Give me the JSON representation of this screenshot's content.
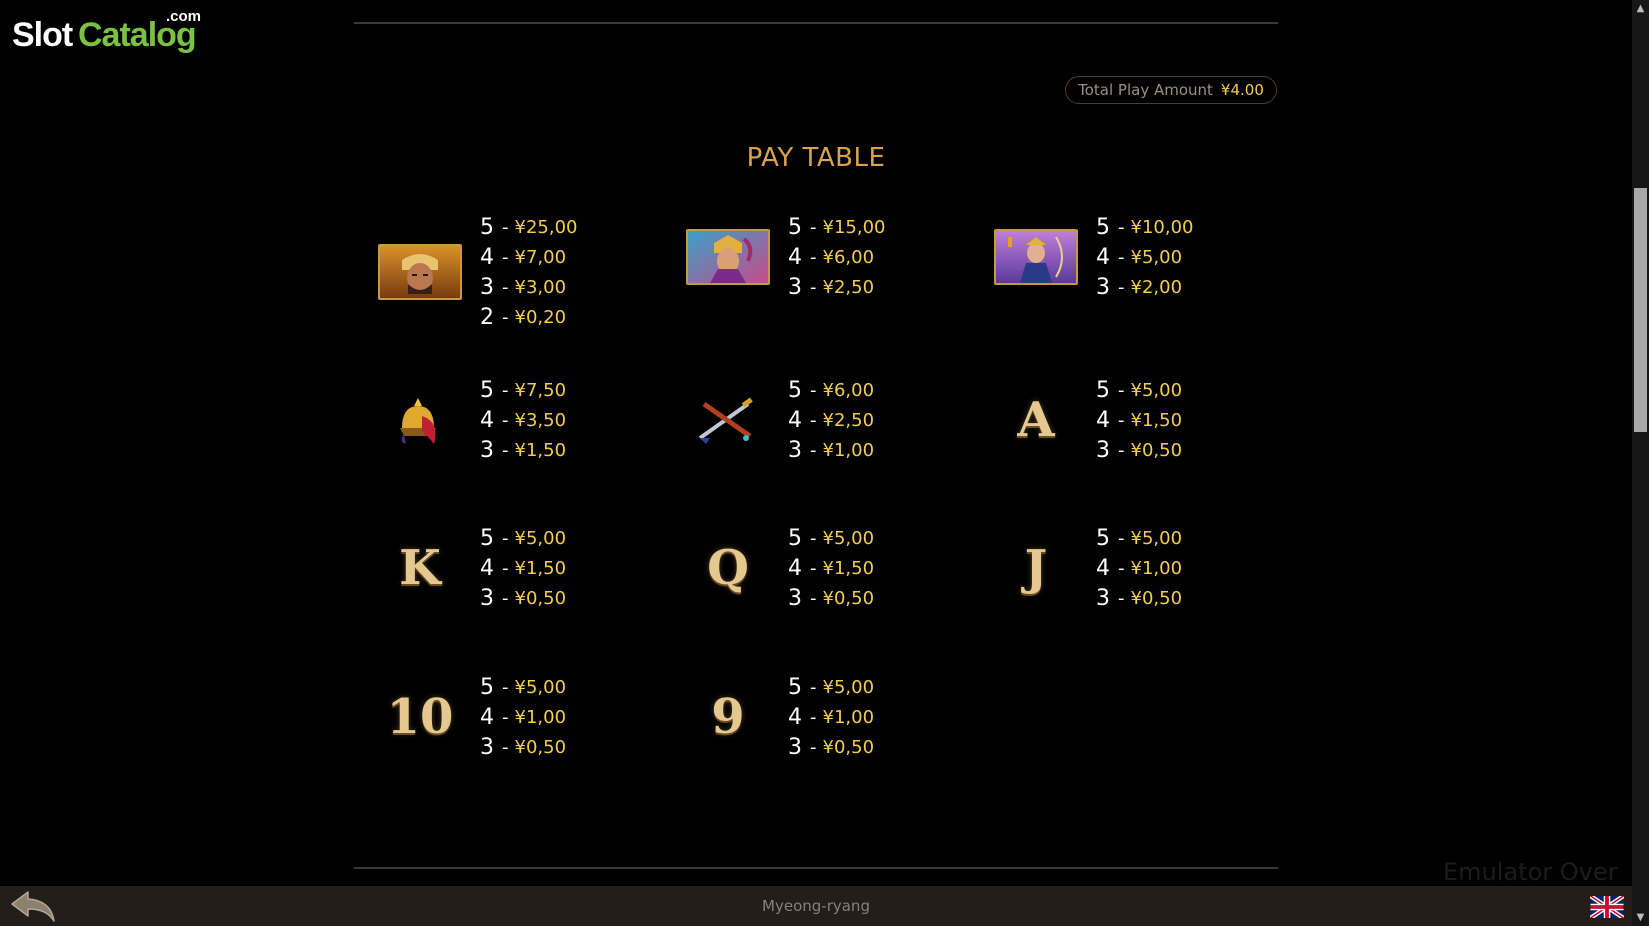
{
  "branding": {
    "logo_slot": "Slot",
    "logo_catalog": "Catalog",
    "logo_dotcom": ".com"
  },
  "header": {
    "total_label": "Total Play Amount",
    "total_value": "¥4.00"
  },
  "title": "PAY TABLE",
  "symbols": [
    {
      "icon": "warrior-general-icon",
      "type": "portrait",
      "pays": [
        {
          "count": "5",
          "amount": "¥25,00"
        },
        {
          "count": "4",
          "amount": "¥7,00"
        },
        {
          "count": "3",
          "amount": "¥3,00"
        },
        {
          "count": "2",
          "amount": "¥0,20"
        }
      ]
    },
    {
      "icon": "samurai-warrior-icon",
      "type": "portrait",
      "pays": [
        {
          "count": "5",
          "amount": "¥15,00"
        },
        {
          "count": "4",
          "amount": "¥6,00"
        },
        {
          "count": "3",
          "amount": "¥2,50"
        }
      ]
    },
    {
      "icon": "archer-warrior-icon",
      "type": "portrait",
      "pays": [
        {
          "count": "5",
          "amount": "¥10,00"
        },
        {
          "count": "4",
          "amount": "¥5,00"
        },
        {
          "count": "3",
          "amount": "¥2,00"
        }
      ]
    },
    {
      "icon": "helmet-icon",
      "type": "item",
      "pays": [
        {
          "count": "5",
          "amount": "¥7,50"
        },
        {
          "count": "4",
          "amount": "¥3,50"
        },
        {
          "count": "3",
          "amount": "¥1,50"
        }
      ]
    },
    {
      "icon": "crossed-swords-icon",
      "type": "item",
      "pays": [
        {
          "count": "5",
          "amount": "¥6,00"
        },
        {
          "count": "4",
          "amount": "¥2,50"
        },
        {
          "count": "3",
          "amount": "¥1,00"
        }
      ]
    },
    {
      "icon": "letter-a-icon",
      "type": "letter",
      "glyph": "A",
      "pays": [
        {
          "count": "5",
          "amount": "¥5,00"
        },
        {
          "count": "4",
          "amount": "¥1,50"
        },
        {
          "count": "3",
          "amount": "¥0,50"
        }
      ]
    },
    {
      "icon": "letter-k-icon",
      "type": "letter",
      "glyph": "K",
      "pays": [
        {
          "count": "5",
          "amount": "¥5,00"
        },
        {
          "count": "4",
          "amount": "¥1,50"
        },
        {
          "count": "3",
          "amount": "¥0,50"
        }
      ]
    },
    {
      "icon": "letter-q-icon",
      "type": "letter",
      "glyph": "Q",
      "pays": [
        {
          "count": "5",
          "amount": "¥5,00"
        },
        {
          "count": "4",
          "amount": "¥1,50"
        },
        {
          "count": "3",
          "amount": "¥0,50"
        }
      ]
    },
    {
      "icon": "letter-j-icon",
      "type": "letter",
      "glyph": "J",
      "pays": [
        {
          "count": "5",
          "amount": "¥5,00"
        },
        {
          "count": "4",
          "amount": "¥1,00"
        },
        {
          "count": "3",
          "amount": "¥0,50"
        }
      ]
    },
    {
      "icon": "number-10-icon",
      "type": "letter",
      "glyph": "10",
      "pays": [
        {
          "count": "5",
          "amount": "¥5,00"
        },
        {
          "count": "4",
          "amount": "¥1,00"
        },
        {
          "count": "3",
          "amount": "¥0,50"
        }
      ]
    },
    {
      "icon": "number-9-icon",
      "type": "letter",
      "glyph": "9",
      "pays": [
        {
          "count": "5",
          "amount": "¥5,00"
        },
        {
          "count": "4",
          "amount": "¥1,00"
        },
        {
          "count": "3",
          "amount": "¥0,50"
        }
      ]
    }
  ],
  "footer": {
    "game_name": "Myeong-ryang",
    "back_icon": "back-arrow-icon",
    "flag_icon": "uk-flag-icon"
  },
  "watermark": "Emulator Over",
  "colors": {
    "background": "#000000",
    "title": "#d8a24e",
    "amount": "#f2cd52",
    "count": "#ffffff",
    "footer": "#231e19",
    "logo_green": "#7cc242"
  }
}
